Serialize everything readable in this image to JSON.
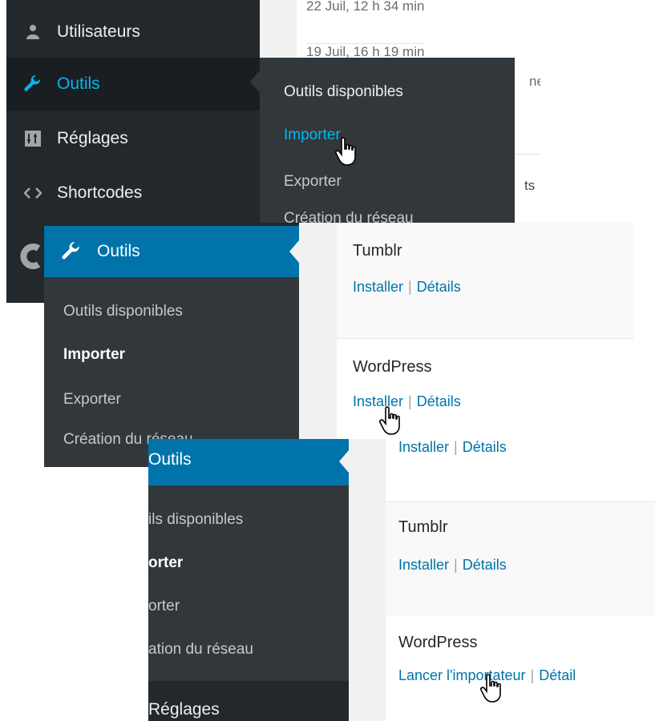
{
  "panel1": {
    "background_list": {
      "dates": [
        "22 Juil, 12 h 34 min",
        "19 Juil, 16 h 19 min"
      ],
      "partial_text_1": "ner",
      "partial_text_2": "ts"
    },
    "sidebar": {
      "items": [
        {
          "label": "Utilisateurs",
          "icon": "user-icon"
        },
        {
          "label": "Outils",
          "icon": "wrench-icon",
          "active": true
        },
        {
          "label": "Réglages",
          "icon": "settings-icon"
        },
        {
          "label": "Shortcodes",
          "icon": "code-icon"
        }
      ]
    },
    "flyout": {
      "items": [
        "Outils disponibles",
        "Importer",
        "Exporter",
        "Création du réseau"
      ]
    }
  },
  "panel2": {
    "menu_header": "Outils",
    "submenu": [
      "Outils disponibles",
      "Importer",
      "Exporter",
      "Création du réseau"
    ],
    "importers": [
      {
        "name": "Tumblr",
        "install": "Installer",
        "details": "Détails"
      },
      {
        "name": "WordPress",
        "install": "Installer",
        "details": "Détails"
      }
    ]
  },
  "panel3": {
    "menu_header": "Outils",
    "submenu": [
      "ils disponibles",
      "orter",
      "orter",
      "ation du réseau"
    ],
    "next_menu": "Réglages",
    "top_links": {
      "install": "Installer",
      "details": "Détails"
    },
    "importers": [
      {
        "name": "Tumblr",
        "install": "Installer",
        "details": "Détails"
      },
      {
        "name": "WordPress",
        "install": "Lancer l'importateur",
        "details": "Détail"
      }
    ]
  },
  "colors": {
    "sidebar_bg": "#23282d",
    "submenu_bg": "#32373c",
    "accent": "#0073aa",
    "highlight_text": "#00b9eb"
  }
}
